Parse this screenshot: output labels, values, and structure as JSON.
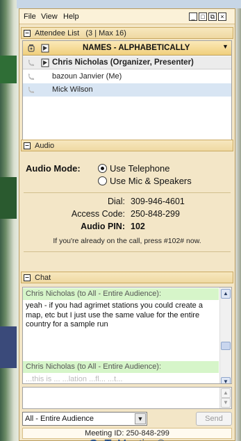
{
  "menu": {
    "file": "File",
    "view": "View",
    "help": "Help"
  },
  "window_buttons": {
    "minimize": "_",
    "restore": "□",
    "popout": "⧉",
    "close": "×"
  },
  "attendee": {
    "section_title": "Attendee List",
    "count_text": "(3 | Max 16)",
    "column_title": "NAMES - ALPHABETICALLY",
    "rows": [
      {
        "name": "Chris Nicholas (Organizer, Presenter)"
      },
      {
        "name": "bazoun Janvier (Me)"
      },
      {
        "name": "Mick Wilson"
      }
    ]
  },
  "audio": {
    "section_title": "Audio",
    "mode_label": "Audio Mode:",
    "option_telephone": "Use Telephone",
    "option_mic": "Use Mic & Speakers",
    "selected": "Use Telephone",
    "dial_label": "Dial:",
    "dial_value": "309-946-4601",
    "access_label": "Access Code:",
    "access_value": "250-848-299",
    "pin_label": "Audio PIN:",
    "pin_value": "102",
    "note": "If you're already on the call, press #102# now."
  },
  "chat": {
    "section_title": "Chat",
    "messages": [
      {
        "sender": "Chris Nicholas (to All - Entire Audience):",
        "text": "yeah - if you had agrimet stations you could create a map, etc but I just use the same value for the entire country for a sample run"
      },
      {
        "sender": "Chris Nicholas (to All - Entire Audience):",
        "text": "...this is ... ...lation ...fl... ...t..."
      }
    ],
    "recipient": "All - Entire Audience",
    "send_label": "Send"
  },
  "footer": {
    "meeting_id": "Meeting ID: 250-848-299",
    "brand_bold": "GoTo",
    "brand_light": "Meeting®"
  },
  "colors": {
    "panel_bg": "#f3e6c7",
    "header_bg": "#efd9a2",
    "chat_sender_bg": "#d6f5c9",
    "selected_row_bg": "#d8e5f3"
  }
}
